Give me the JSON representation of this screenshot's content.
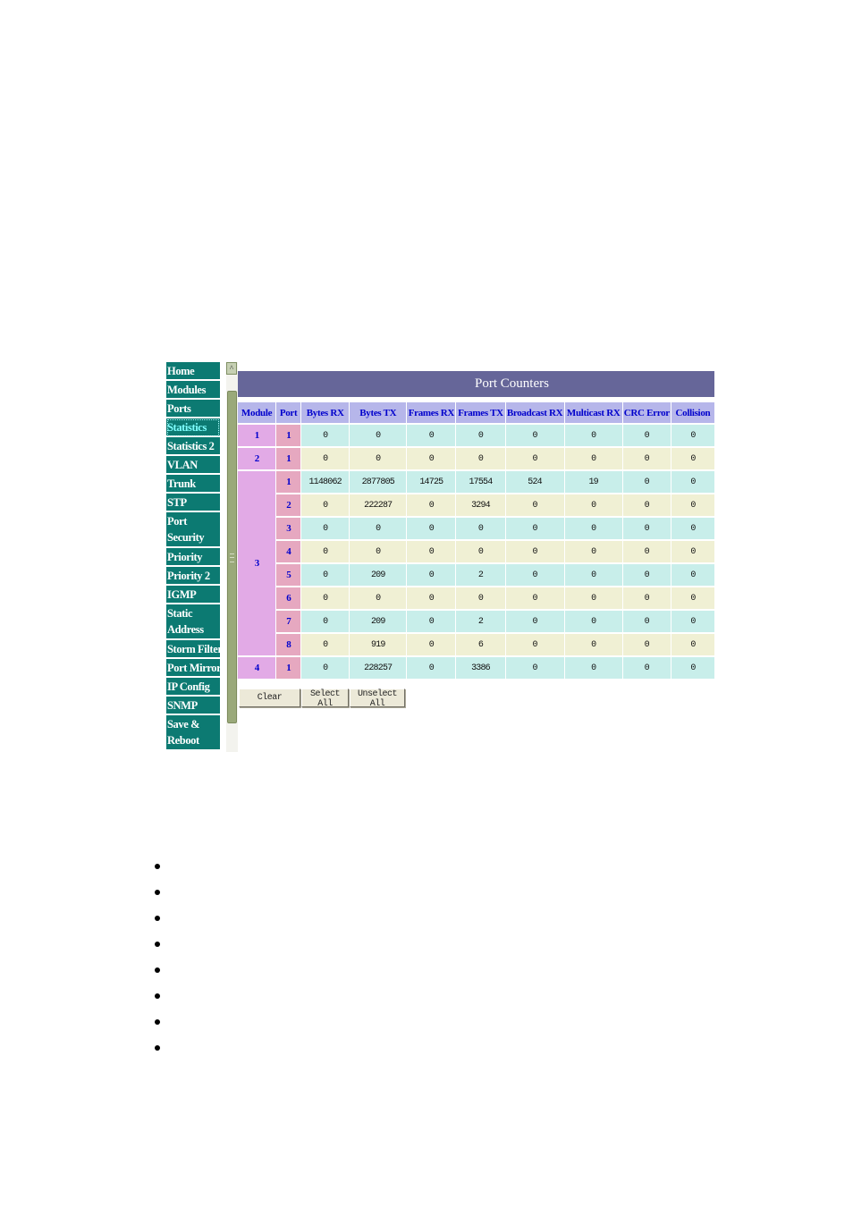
{
  "nav": {
    "items": [
      {
        "label": "Home",
        "lines": 1
      },
      {
        "label": "Modules",
        "lines": 1
      },
      {
        "label": "Ports",
        "lines": 1
      },
      {
        "label": "Statistics",
        "lines": 1,
        "active": true
      },
      {
        "label": "Statistics 2",
        "lines": 1
      },
      {
        "label": "VLAN",
        "lines": 1
      },
      {
        "label": "Trunk",
        "lines": 1
      },
      {
        "label": "STP",
        "lines": 1
      },
      {
        "label": "Port Security",
        "lines": 2
      },
      {
        "label": "Priority",
        "lines": 1
      },
      {
        "label": "Priority 2",
        "lines": 1
      },
      {
        "label": "IGMP",
        "lines": 1
      },
      {
        "label": "Static Address",
        "lines": 2
      },
      {
        "label": "Storm Filter",
        "lines": 1
      },
      {
        "label": "Port Mirror",
        "lines": 1
      },
      {
        "label": "IP Config",
        "lines": 1
      },
      {
        "label": "SNMP",
        "lines": 1
      },
      {
        "label": "Save & Reboot",
        "lines": 2
      }
    ]
  },
  "scrollbar": {
    "up_icon": "chevron-up-icon"
  },
  "panel": {
    "title": "Port Counters",
    "columns": [
      "Module",
      "Port",
      "Bytes RX",
      "Bytes TX",
      "Frames RX",
      "Frames TX",
      "Broadcast RX",
      "Multicast RX",
      "CRC Error",
      "Collision"
    ],
    "modules": [
      {
        "module": "1",
        "ports": [
          {
            "port": "1",
            "values": [
              "0",
              "0",
              "0",
              "0",
              "0",
              "0",
              "0",
              "0"
            ]
          }
        ]
      },
      {
        "module": "2",
        "ports": [
          {
            "port": "1",
            "values": [
              "0",
              "0",
              "0",
              "0",
              "0",
              "0",
              "0",
              "0"
            ]
          }
        ]
      },
      {
        "module": "3",
        "ports": [
          {
            "port": "1",
            "values": [
              "1148062",
              "2877805",
              "14725",
              "17554",
              "524",
              "19",
              "0",
              "0"
            ]
          },
          {
            "port": "2",
            "values": [
              "0",
              "222287",
              "0",
              "3294",
              "0",
              "0",
              "0",
              "0"
            ]
          },
          {
            "port": "3",
            "values": [
              "0",
              "0",
              "0",
              "0",
              "0",
              "0",
              "0",
              "0"
            ]
          },
          {
            "port": "4",
            "values": [
              "0",
              "0",
              "0",
              "0",
              "0",
              "0",
              "0",
              "0"
            ]
          },
          {
            "port": "5",
            "values": [
              "0",
              "209",
              "0",
              "2",
              "0",
              "0",
              "0",
              "0"
            ]
          },
          {
            "port": "6",
            "values": [
              "0",
              "0",
              "0",
              "0",
              "0",
              "0",
              "0",
              "0"
            ]
          },
          {
            "port": "7",
            "values": [
              "0",
              "209",
              "0",
              "2",
              "0",
              "0",
              "0",
              "0"
            ]
          },
          {
            "port": "8",
            "values": [
              "0",
              "919",
              "0",
              "6",
              "0",
              "0",
              "0",
              "0"
            ]
          }
        ]
      },
      {
        "module": "4",
        "ports": [
          {
            "port": "1",
            "values": [
              "0",
              "228257",
              "0",
              "3386",
              "0",
              "0",
              "0",
              "0"
            ]
          }
        ]
      }
    ]
  },
  "buttons": {
    "clear": "Clear",
    "select_all": "Select All",
    "unselect_all": "Unselect All"
  },
  "bullets": {
    "count": 8
  }
}
